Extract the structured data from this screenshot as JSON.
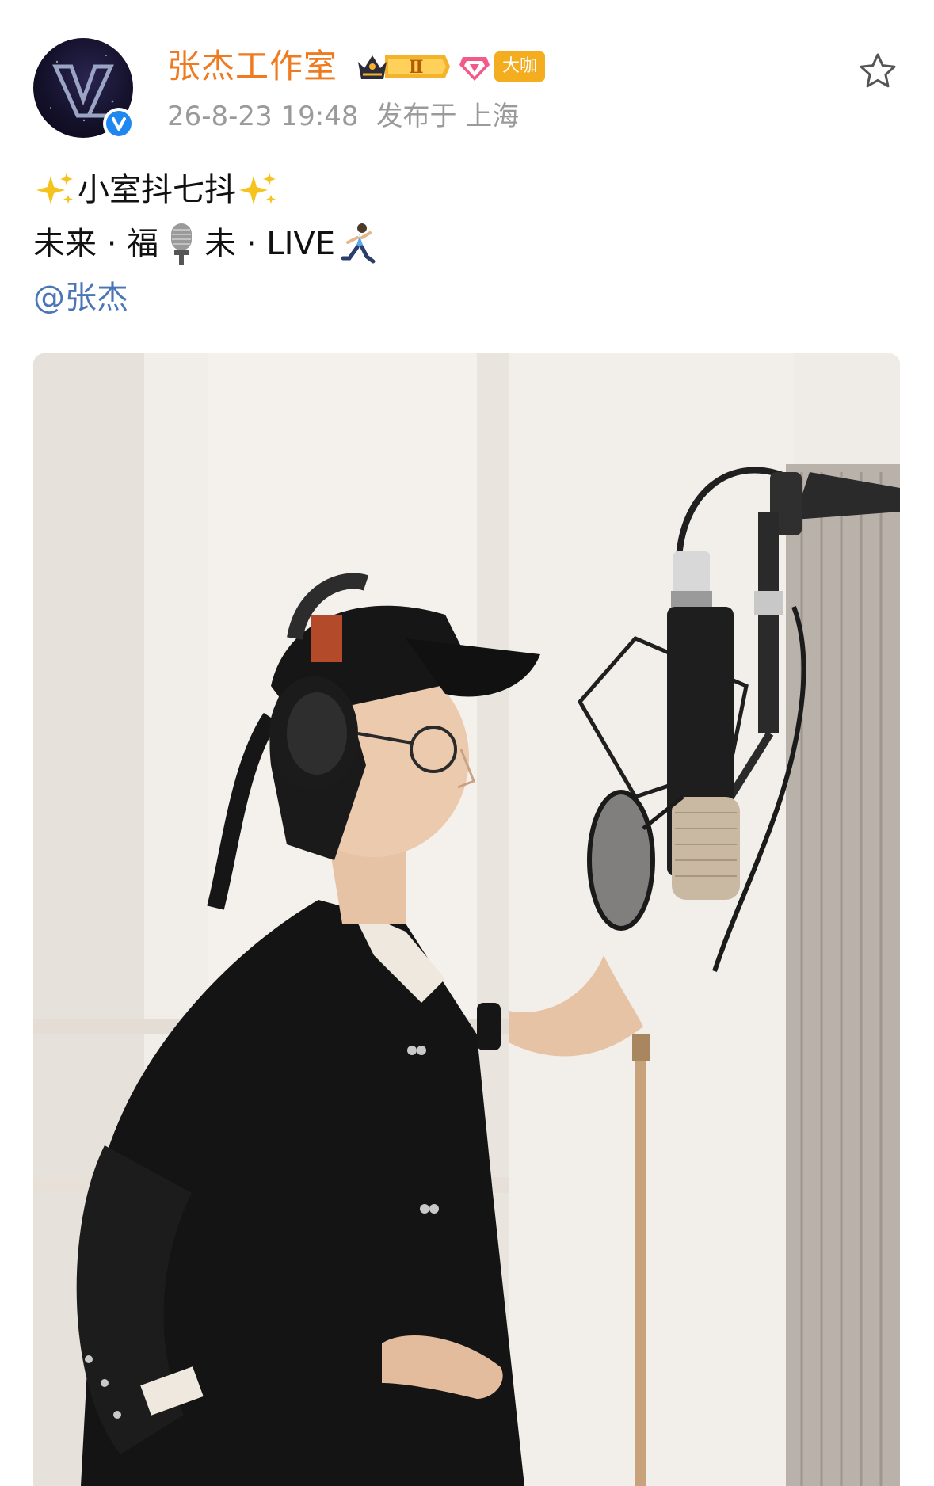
{
  "post": {
    "author": {
      "name": "张杰工作室",
      "avatar_icon": "avatar-logo",
      "verified_icon": "verified-badge-icon",
      "badges": {
        "crown_level": "Ⅱ",
        "vip_label": "大咖"
      }
    },
    "meta": {
      "timestamp": "26-8-23 19:48",
      "location": "发布于 上海"
    },
    "favorite_icon": "star-icon",
    "content": {
      "line1": "小室抖七抖",
      "line2_part1": "未来 · 福",
      "line2_part2": "未 · LIVE",
      "mention": "@张杰"
    },
    "photo": {
      "subject": "recording-studio-photo"
    }
  },
  "colors": {
    "username": "#ef7a1f",
    "meta_text": "#9a9a9a",
    "mention": "#4a76b8",
    "verified": "#1e88f0",
    "vip_badge": "#f3ad1e"
  }
}
